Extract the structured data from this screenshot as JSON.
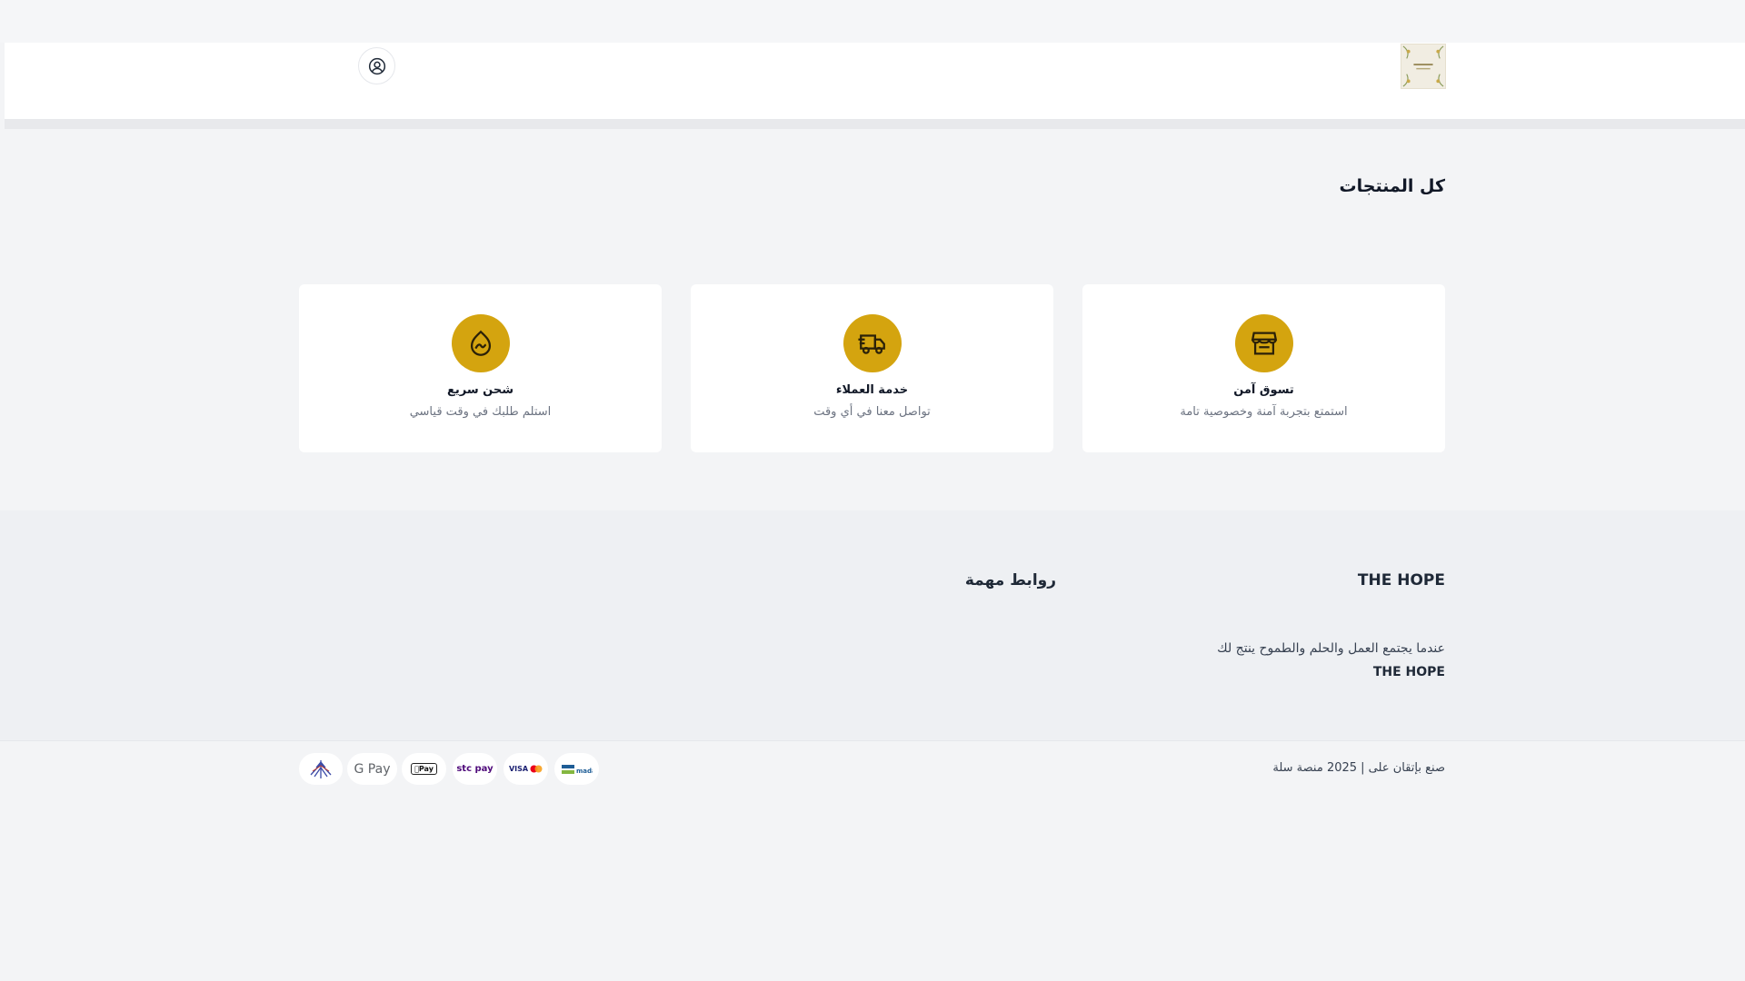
{
  "header": {
    "logo_alt": "THE HOPE logo",
    "account_icon": "user-circle-icon"
  },
  "main": {
    "title": "كل المنتجات",
    "features": [
      {
        "icon": "store-icon",
        "title": "تسوق آمن",
        "desc": "استمتع بتجربة آمنة وخصوصية تامة"
      },
      {
        "icon": "delivery-truck-icon",
        "title": "خدمة العملاء",
        "desc": "تواصل معنا في أي وقت"
      },
      {
        "icon": "shipping-flame-icon",
        "title": "شحن سريع",
        "desc": "استلم طلبك في وقت قياسي"
      }
    ],
    "accent_color": "#d4a40f"
  },
  "footer": {
    "brand": "THE HOPE",
    "links_title": "روابط مهمة",
    "tagline": "عندما يجتمع العمل والحلم والطموح ينتج لك",
    "tagline_brand": "THE HOPE",
    "copyright": "صنع بإتقان على | 2025 منصة سلة",
    "payment_methods": [
      {
        "name": "mada",
        "label": "mada"
      },
      {
        "name": "visa-mastercard",
        "label": "VISA"
      },
      {
        "name": "stc-pay",
        "label": "stc pay"
      },
      {
        "name": "apple-pay",
        "label": "Pay"
      },
      {
        "name": "google-pay",
        "label": "G Pay"
      },
      {
        "name": "tamara",
        "label": ""
      }
    ]
  }
}
